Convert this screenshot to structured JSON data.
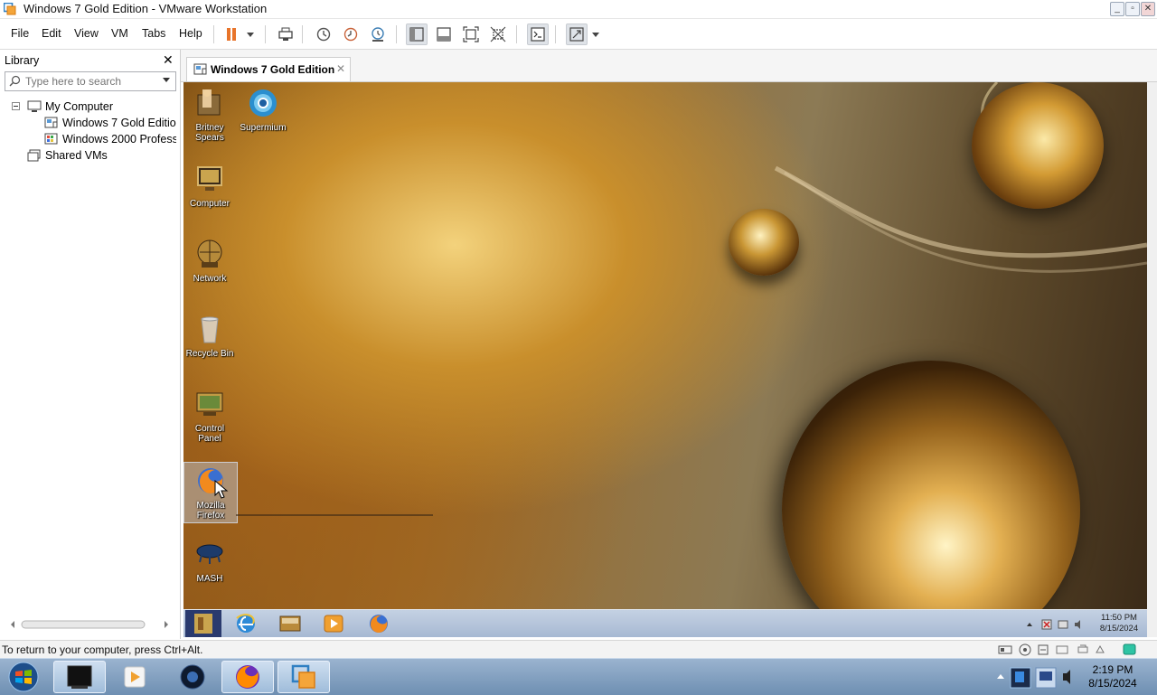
{
  "window": {
    "title": "Windows 7 Gold Edition - VMware Workstation",
    "controls": [
      "minimize",
      "restore",
      "close"
    ]
  },
  "menu": {
    "items": [
      "File",
      "Edit",
      "View",
      "VM",
      "Tabs",
      "Help"
    ]
  },
  "toolbar": {
    "buttons": [
      "pause-icon",
      "dropdown-arrow-icon",
      "send-ctrl-alt-del-icon",
      "snapshot-icon",
      "revert-snapshot-icon",
      "snapshot-manager-icon",
      "show-library-icon",
      "thumbnail-bar-icon",
      "fit-guest-icon",
      "unity-icon",
      "console-view-icon",
      "fullscreen-icon",
      "dropdown-arrow-icon"
    ]
  },
  "library": {
    "title": "Library",
    "search_placeholder": "Type here to search",
    "tree": [
      {
        "label": "My Computer",
        "level": 0
      },
      {
        "label": "Windows 7 Gold Edition",
        "level": 1
      },
      {
        "label": "Windows 2000 Professional",
        "level": 1
      },
      {
        "label": "Shared VMs",
        "level": 0
      }
    ]
  },
  "tabs": [
    {
      "label": "Windows 7 Gold Edition",
      "active": true
    }
  ],
  "guest": {
    "desktop_icons": [
      {
        "label": "Britney Spears",
        "icon": "folder-person-icon"
      },
      {
        "label": "Supermium",
        "icon": "browser-icon"
      },
      {
        "label": "Computer",
        "icon": "computer-icon"
      },
      {
        "label": "Network",
        "icon": "network-icon"
      },
      {
        "label": "Recycle Bin",
        "icon": "recycle-bin-icon"
      },
      {
        "label": "Control Panel",
        "icon": "control-panel-icon"
      },
      {
        "label": "Mozilla Firefox",
        "icon": "firefox-icon"
      },
      {
        "label": "MASH",
        "icon": "mash-icon"
      }
    ],
    "taskbar": {
      "pinned": [
        "internet-explorer-icon",
        "file-explorer-icon",
        "media-player-icon",
        "firefox-icon"
      ],
      "clock_time": "11:50 PM",
      "clock_date": "8/15/2024"
    }
  },
  "statusbar": {
    "message": "To return to your computer, press Ctrl+Alt."
  },
  "host_taskbar": {
    "items": [
      "start-orb-icon",
      "vm-black-icon",
      "media-player-icon",
      "supermium-icon",
      "firefox-icon",
      "vmware-icon"
    ],
    "clock_time": "2:19 PM",
    "clock_date": "8/15/2024"
  },
  "colors": {
    "pause_accent": "#e8742a",
    "host_taskbar": "#7f9dbf",
    "guest_taskbar": "#b5c5dc"
  }
}
